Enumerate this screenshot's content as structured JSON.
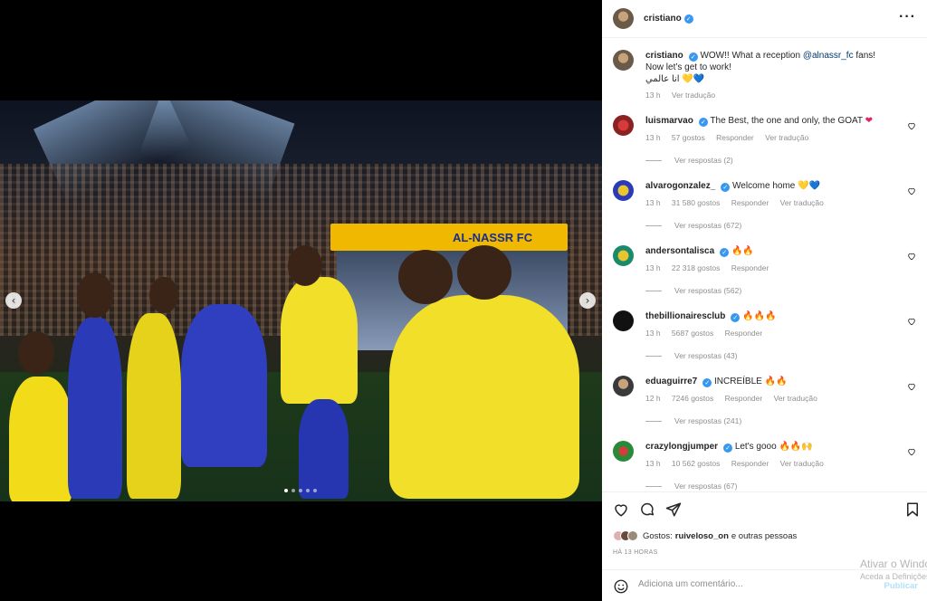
{
  "post": {
    "username": "cristiano",
    "caption": {
      "username": "cristiano",
      "line1": "WOW!! What a reception",
      "mention": "@alnassr_fc",
      "line1_end": "fans!",
      "line2": "Now let’s get to work!",
      "line3": "انا عالمي",
      "line3_emoji": "💛💙",
      "time": "13 h",
      "translate": "Ver tradução"
    },
    "photo": {
      "banner_text": "AL-NASSR FC",
      "dots": 5,
      "active_dot": 0
    }
  },
  "comments": [
    {
      "username": "luismarvao",
      "verified": true,
      "text": "The Best, the one and only, the GOAT",
      "emoji": "❤",
      "time": "13 h",
      "likes": "57 gostos",
      "reply": "Responder",
      "translate": "Ver tradução",
      "replies": "Ver respostas (2)"
    },
    {
      "username": "alvarogonzalez_",
      "verified": true,
      "text": "Welcome home",
      "emoji": "💛💙",
      "time": "13 h",
      "likes": "31 580 gostos",
      "reply": "Responder",
      "translate": "Ver tradução",
      "replies": "Ver respostas (672)"
    },
    {
      "username": "andersontalisca",
      "verified": true,
      "text": "",
      "emoji": "🔥🔥",
      "time": "13 h",
      "likes": "22 318 gostos",
      "reply": "Responder",
      "translate": "",
      "replies": "Ver respostas (562)"
    },
    {
      "username": "thebillionairesclub",
      "verified": true,
      "text": "",
      "emoji": "🔥🔥🔥",
      "time": "13 h",
      "likes": "5687 gostos",
      "reply": "Responder",
      "translate": "",
      "replies": "Ver respostas (43)"
    },
    {
      "username": "eduaguirre7",
      "verified": true,
      "text": "INCREÍBLE",
      "emoji": "🔥🔥",
      "time": "12 h",
      "likes": "7246 gostos",
      "reply": "Responder",
      "translate": "Ver tradução",
      "replies": "Ver respostas (241)"
    },
    {
      "username": "crazylongjumper",
      "verified": true,
      "text": "Let's gooo",
      "emoji": "🔥🔥🙌",
      "time": "13 h",
      "likes": "10 562 gostos",
      "reply": "Responder",
      "translate": "Ver tradução",
      "replies": "Ver respostas (67)"
    }
  ],
  "actions": {
    "likes_prefix": "Gostos:",
    "likes_user": "ruiveloso_on",
    "likes_suffix": "e outras pessoas",
    "ago": "HÁ 13 HORAS",
    "comment_placeholder": "Adiciona um comentário...",
    "publish": "Publicar"
  },
  "watermark": {
    "line1": "Ativar o Windows",
    "line2": "Aceda a Definições"
  },
  "colors": {
    "accent": "#3897f0",
    "publish": "#b2dffc",
    "banner": "#f0b800"
  }
}
